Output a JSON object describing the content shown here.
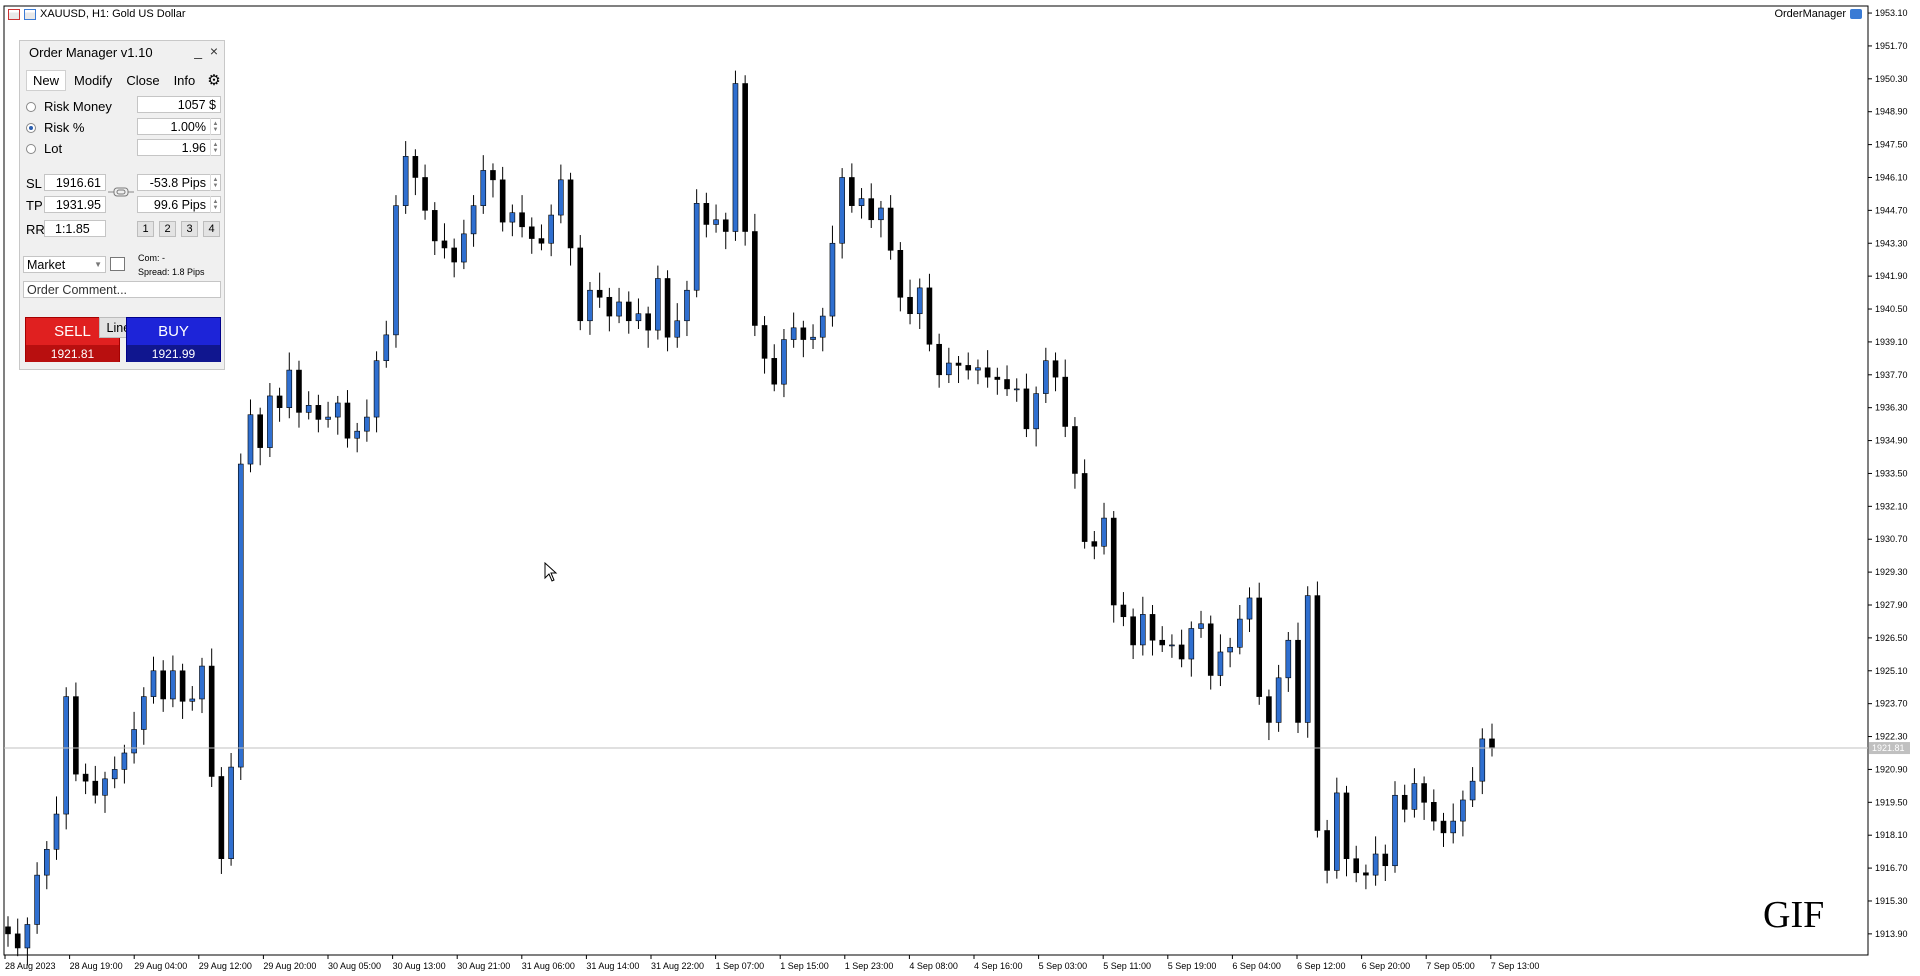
{
  "header": {
    "symbol_title": "XAUUSD, H1:  Gold US Dollar",
    "expert_name": "OrderManager"
  },
  "watermark": "GIF",
  "panel": {
    "title": "Order Manager v1.10",
    "minimize_glyph": "_",
    "close_glyph": "×",
    "tabs": [
      "New",
      "Modify",
      "Close",
      "Info"
    ],
    "active_tab": "New",
    "risk_options": [
      {
        "label": "Risk Money",
        "value": "1057 $",
        "selected": false
      },
      {
        "label": "Risk %",
        "value": "1.00%",
        "selected": true
      },
      {
        "label": "Lot",
        "value": "1.96",
        "selected": false
      }
    ],
    "sl": {
      "label": "SL",
      "price": "1916.61",
      "pips": "-53.8 Pips"
    },
    "tp": {
      "label": "TP",
      "price": "1931.95",
      "pips": "99.6 Pips"
    },
    "rr": {
      "label": "RR",
      "value": "1:1.85",
      "buttons": [
        "1",
        "2",
        "3",
        "4"
      ]
    },
    "order_type": "Market",
    "commission": "Com: -",
    "spread": "Spread: 1.8 Pips",
    "comment_placeholder": "Order Comment...",
    "sell": {
      "label": "SELL",
      "price": "1921.81"
    },
    "lines_label": "Lines",
    "buy": {
      "label": "BUY",
      "price": "1921.99"
    }
  },
  "chart_data": {
    "type": "candlestick",
    "symbol": "XAUUSD",
    "timeframe": "H1",
    "y_ticks": [
      "1953.10",
      "1951.70",
      "1950.30",
      "1948.90",
      "1947.50",
      "1946.10",
      "1944.70",
      "1943.30",
      "1941.90",
      "1940.50",
      "1939.10",
      "1937.70",
      "1936.30",
      "1934.90",
      "1933.50",
      "1932.10",
      "1930.70",
      "1929.30",
      "1927.90",
      "1926.50",
      "1925.10",
      "1923.70",
      "1922.30",
      "1920.90",
      "1919.50",
      "1918.10",
      "1916.70",
      "1915.30",
      "1913.90"
    ],
    "ylim": [
      1913.0,
      1953.4
    ],
    "x_ticks": [
      "28 Aug 2023",
      "28 Aug 19:00",
      "29 Aug 04:00",
      "29 Aug 12:00",
      "29 Aug 20:00",
      "30 Aug 05:00",
      "30 Aug 13:00",
      "30 Aug 21:00",
      "31 Aug 06:00",
      "31 Aug 14:00",
      "31 Aug 22:00",
      "1 Sep 07:00",
      "1 Sep 15:00",
      "1 Sep 23:00",
      "4 Sep 08:00",
      "4 Sep 16:00",
      "5 Sep 03:00",
      "5 Sep 11:00",
      "5 Sep 19:00",
      "6 Sep 04:00",
      "6 Sep 12:00",
      "6 Sep 20:00",
      "7 Sep 05:00",
      "7 Sep 13:00"
    ],
    "bid_line": 1921.81,
    "bid_label": "1921.81",
    "up_color": "#2f6fd0",
    "down_color": "#000000",
    "closes": [
      1913.9,
      1913.3,
      1914.3,
      1916.4,
      1917.5,
      1919.0,
      1924.0,
      1920.7,
      1920.4,
      1919.8,
      1920.5,
      1920.9,
      1921.6,
      1922.6,
      1924.0,
      1925.1,
      1923.9,
      1925.1,
      1923.8,
      1923.9,
      1925.3,
      1920.6,
      1917.1,
      1921.0,
      1933.9,
      1936.0,
      1934.6,
      1936.8,
      1936.3,
      1937.9,
      1936.1,
      1936.4,
      1935.8,
      1935.9,
      1936.5,
      1935.0,
      1935.3,
      1935.9,
      1938.3,
      1939.4,
      1944.9,
      1947.0,
      1946.1,
      1944.7,
      1943.4,
      1943.1,
      1942.5,
      1943.7,
      1944.9,
      1946.4,
      1946.0,
      1944.2,
      1944.6,
      1944.0,
      1943.5,
      1943.3,
      1944.5,
      1946.0,
      1943.1,
      1940.0,
      1941.3,
      1941.0,
      1940.2,
      1940.8,
      1940.0,
      1940.3,
      1939.6,
      1941.8,
      1939.3,
      1940.0,
      1941.3,
      1945.0,
      1944.1,
      1944.3,
      1943.8,
      1950.1,
      1943.8,
      1939.8,
      1938.4,
      1937.3,
      1939.2,
      1939.7,
      1939.2,
      1939.3,
      1940.2,
      1943.3,
      1946.1,
      1944.9,
      1945.2,
      1944.3,
      1944.8,
      1943.0,
      1941.0,
      1940.3,
      1941.4,
      1939.0,
      1937.7,
      1938.2,
      1938.1,
      1937.9,
      1938.0,
      1937.6,
      1937.5,
      1937.1,
      1937.1,
      1935.4,
      1936.9,
      1938.3,
      1937.6,
      1935.5,
      1933.5,
      1930.6,
      1930.4,
      1931.6,
      1927.9,
      1927.4,
      1926.2,
      1927.5,
      1926.4,
      1926.2,
      1926.2,
      1925.6,
      1926.9,
      1927.1,
      1924.9,
      1925.9,
      1926.1,
      1927.3,
      1928.2,
      1924.0,
      1922.9,
      1924.8,
      1926.4,
      1922.9,
      1928.3,
      1918.3,
      1916.6,
      1919.9,
      1917.1,
      1916.5,
      1916.4,
      1917.3,
      1916.8,
      1919.8,
      1919.2,
      1920.3,
      1919.5,
      1918.7,
      1918.2,
      1918.7,
      1919.6,
      1920.4,
      1922.2,
      1921.8
    ],
    "note": "Approximate hourly close prices read from the chart"
  }
}
